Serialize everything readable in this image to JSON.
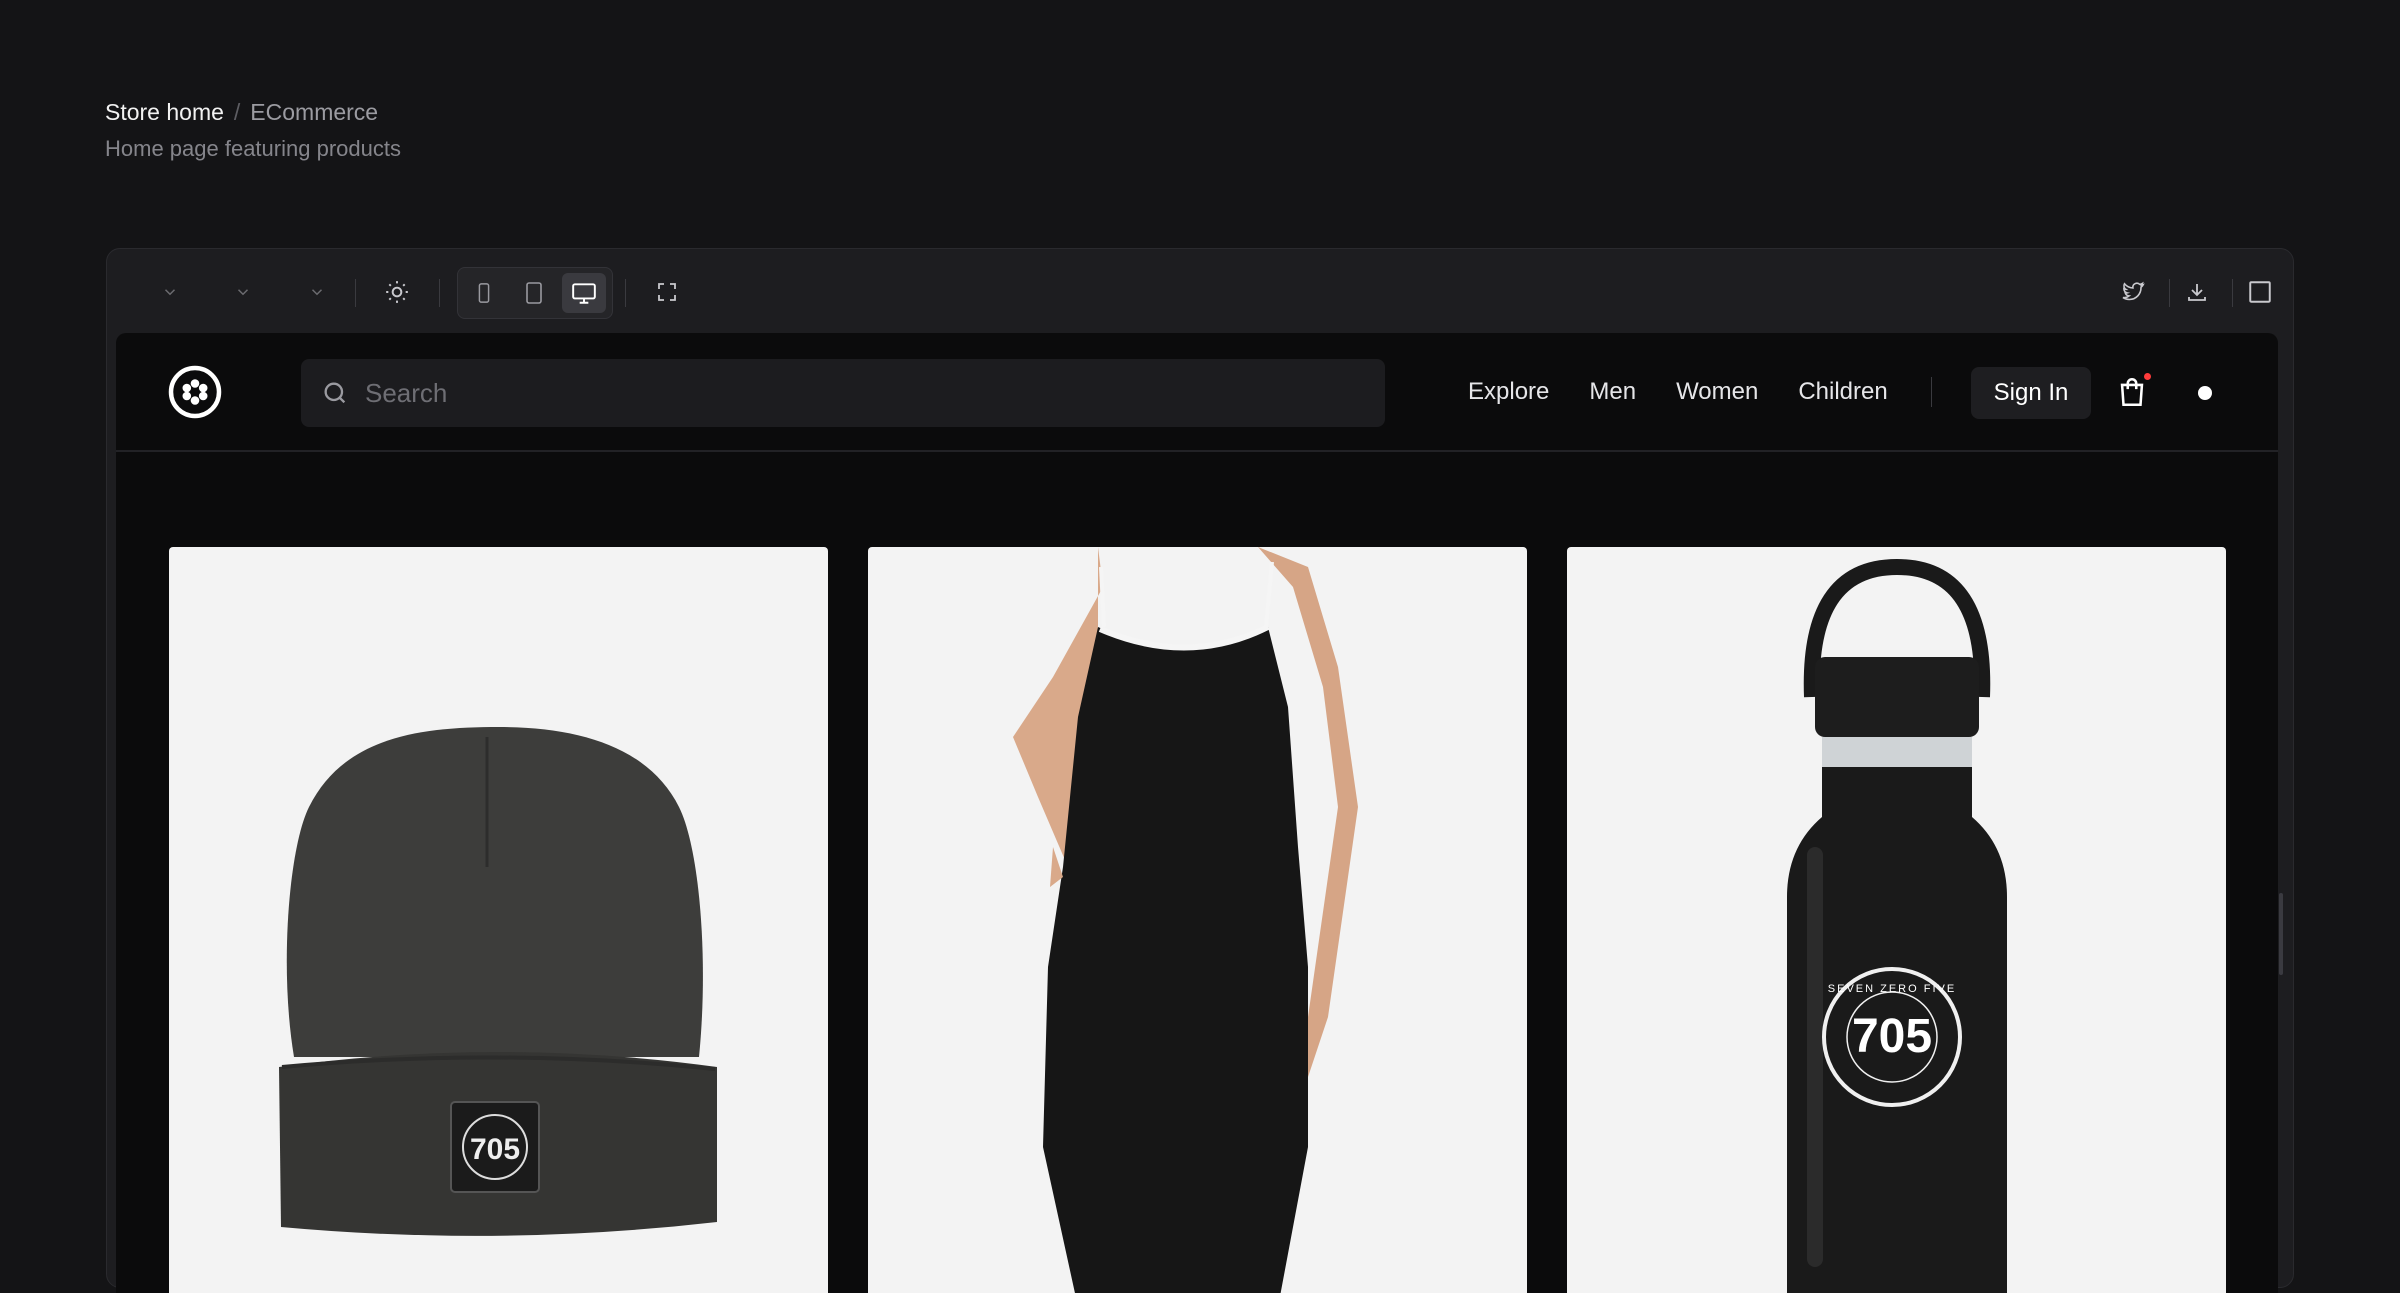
{
  "breadcrumb": {
    "home": "Store home",
    "separator": "/",
    "current": "ECommerce"
  },
  "subtitle": "Home page featuring products",
  "toolbar": {
    "dropdowns": [
      "chevron-down-icon",
      "chevron-down-icon",
      "chevron-down-icon"
    ],
    "theme_icon": "sun-icon",
    "devices": [
      "mobile-icon",
      "tablet-icon",
      "desktop-icon"
    ],
    "active_device": "desktop",
    "fullscreen_icon": "expand-icon",
    "right_icons": [
      "twitter-icon",
      "download-icon",
      "panel-icon"
    ]
  },
  "store": {
    "search_placeholder": "Search",
    "nav": [
      "Explore",
      "Men",
      "Women",
      "Children"
    ],
    "sign_in": "Sign In",
    "cart_has_items": true
  },
  "products": [
    {
      "name": "beanie",
      "badge_text": "705"
    },
    {
      "name": "dress"
    },
    {
      "name": "water-bottle",
      "badge_text": "705",
      "badge_ring": "SEVEN ZERO FIVE"
    }
  ],
  "colors": {
    "page_bg": "#141416",
    "viewport_bg": "#0b0b0c",
    "card_bg": "#f3f3f3",
    "cart_dot": "#ff3b3b"
  }
}
